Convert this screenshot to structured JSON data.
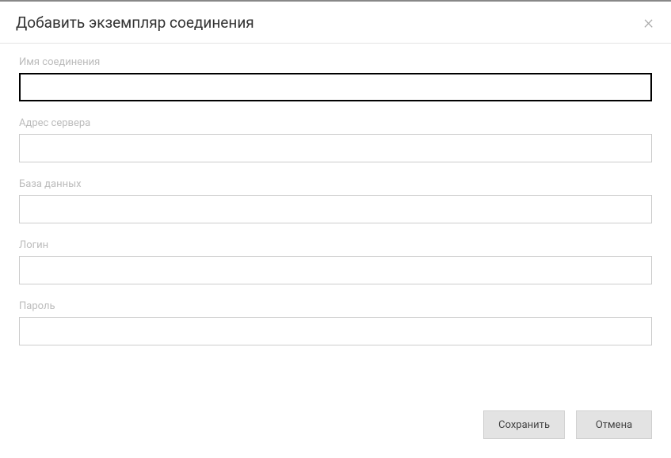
{
  "dialog": {
    "title": "Добавить экземпляр соединения"
  },
  "form": {
    "connection_name": {
      "label": "Имя соединения",
      "value": ""
    },
    "server_address": {
      "label": "Адрес сервера",
      "value": ""
    },
    "database": {
      "label": "База данных",
      "value": ""
    },
    "login": {
      "label": "Логин",
      "value": ""
    },
    "password": {
      "label": "Пароль",
      "value": ""
    }
  },
  "buttons": {
    "save": "Сохранить",
    "cancel": "Отмена"
  }
}
